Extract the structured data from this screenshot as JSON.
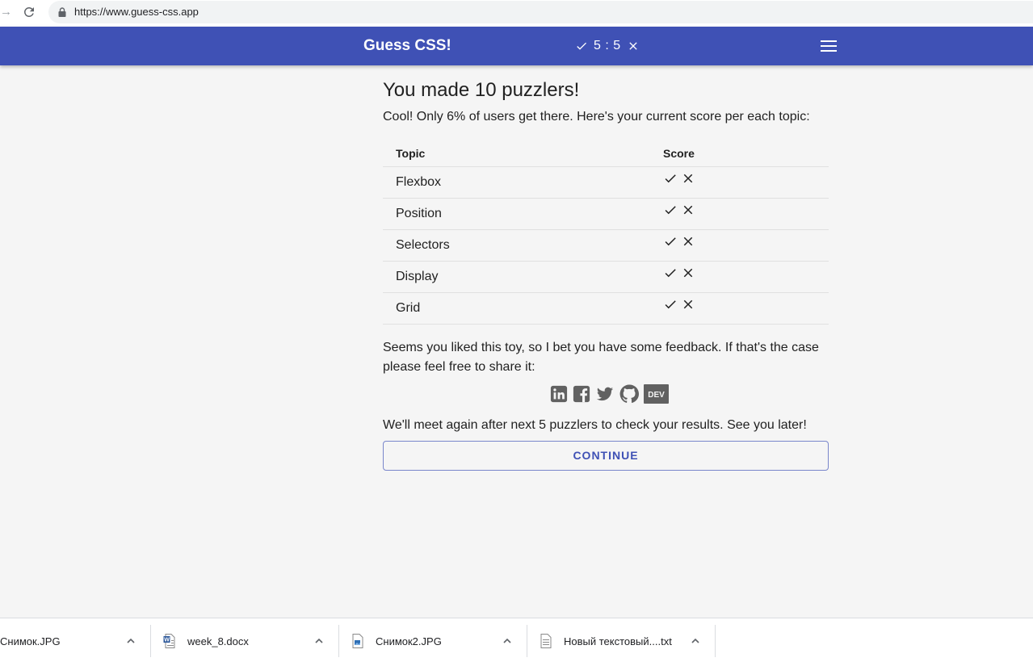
{
  "browser": {
    "url": "https://www.guess-css.app"
  },
  "appbar": {
    "title": "Guess CSS!",
    "score": "5 : 5",
    "colors": {
      "primary": "#3f51b5"
    }
  },
  "main": {
    "heading": "You made 10 puzzlers!",
    "intro": "Cool! Only 6% of users get there. Here's your current score per each topic:",
    "table": {
      "headers": [
        "Topic",
        "Score"
      ],
      "rows": [
        {
          "topic": "Flexbox"
        },
        {
          "topic": "Position"
        },
        {
          "topic": "Selectors"
        },
        {
          "topic": "Display"
        },
        {
          "topic": "Grid"
        }
      ]
    },
    "feedback": "Seems you liked this toy, so I bet you have some feedback. If that's the case please feel free to share it:",
    "social": [
      "linkedin-icon",
      "facebook-icon",
      "twitter-icon",
      "github-icon",
      "dev-icon"
    ],
    "dev_label": "DEV",
    "meet": "We'll meet again after next 5 puzzlers to check your results. See you later!",
    "continue_label": "CONTINUE"
  },
  "downloads": [
    {
      "name": "Снимок.JPG",
      "icon": "image-file-icon"
    },
    {
      "name": "week_8.docx",
      "icon": "word-file-icon"
    },
    {
      "name": "Снимок2.JPG",
      "icon": "image-file-icon"
    },
    {
      "name": "Новый текстовый....txt",
      "icon": "text-file-icon"
    }
  ]
}
